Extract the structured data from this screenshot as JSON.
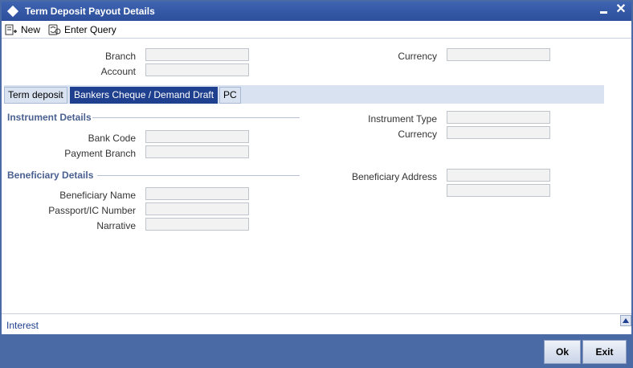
{
  "window": {
    "title": "Term Deposit Payout Details"
  },
  "toolbar": {
    "new_label": "New",
    "enter_query_label": "Enter Query"
  },
  "header_fields": {
    "branch_label": "Branch",
    "account_label": "Account",
    "currency_label": "Currency"
  },
  "tabs": [
    {
      "label": "Term deposit"
    },
    {
      "label": "Bankers Cheque / Demand Draft"
    },
    {
      "label": "PC"
    }
  ],
  "instrument": {
    "section_title": "Instrument Details",
    "bank_code_label": "Bank Code",
    "payment_branch_label": "Payment Branch",
    "instrument_type_label": "Instrument Type",
    "currency_label": "Currency"
  },
  "beneficiary": {
    "section_title": "Beneficiary Details",
    "name_label": "Beneficiary Name",
    "passport_label": "Passport/IC Number",
    "narrative_label": "Narrative",
    "address_label": "Beneficiary Address"
  },
  "bottom": {
    "interest_link": "Interest"
  },
  "footer": {
    "ok_label": "Ok",
    "exit_label": "Exit"
  },
  "colors": {
    "title_bar": "#2d4f9c",
    "footer": "#4a6aa5",
    "active_tab": "#1f3f8f"
  }
}
